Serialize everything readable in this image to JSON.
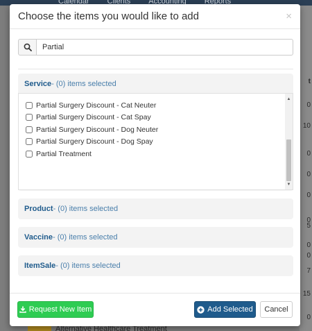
{
  "background": {
    "nav": [
      "Calendar",
      "Clients",
      "Accounting",
      "Reports"
    ],
    "right_column_header": "t",
    "right_column_values": [
      "0",
      "10",
      "0",
      "0",
      "0",
      "0",
      "5",
      "0",
      "0",
      "7",
      "15",
      "0"
    ],
    "bottom_row_text": "Alternative Healthcare Treatment"
  },
  "modal": {
    "title": "Choose the items you would like to add",
    "close_glyph": "×",
    "search": {
      "value": "Partial",
      "placeholder": ""
    },
    "panels": [
      {
        "name": "Service",
        "count": " - (0) items selected",
        "expanded": true,
        "items": [
          "Partial Surgery Discount - Cat Neuter",
          "Partial Surgery Discount - Cat Spay",
          "Partial Surgery Discount - Dog Neuter",
          "Partial Surgery Discount - Dog Spay",
          "Partial Treatment"
        ]
      },
      {
        "name": "Product",
        "count": " - (0) items selected",
        "expanded": false
      },
      {
        "name": "Vaccine",
        "count": " - (0) items selected",
        "expanded": false
      },
      {
        "name": "ItemSale",
        "count": " - (0) items selected",
        "expanded": false
      }
    ],
    "footer": {
      "request_label": "Request New Item",
      "add_label": "Add Selected",
      "cancel_label": "Cancel"
    }
  },
  "colors": {
    "accent": "#1f5b8c",
    "success": "#2ecc52",
    "overlay": "#7d7d7d"
  }
}
